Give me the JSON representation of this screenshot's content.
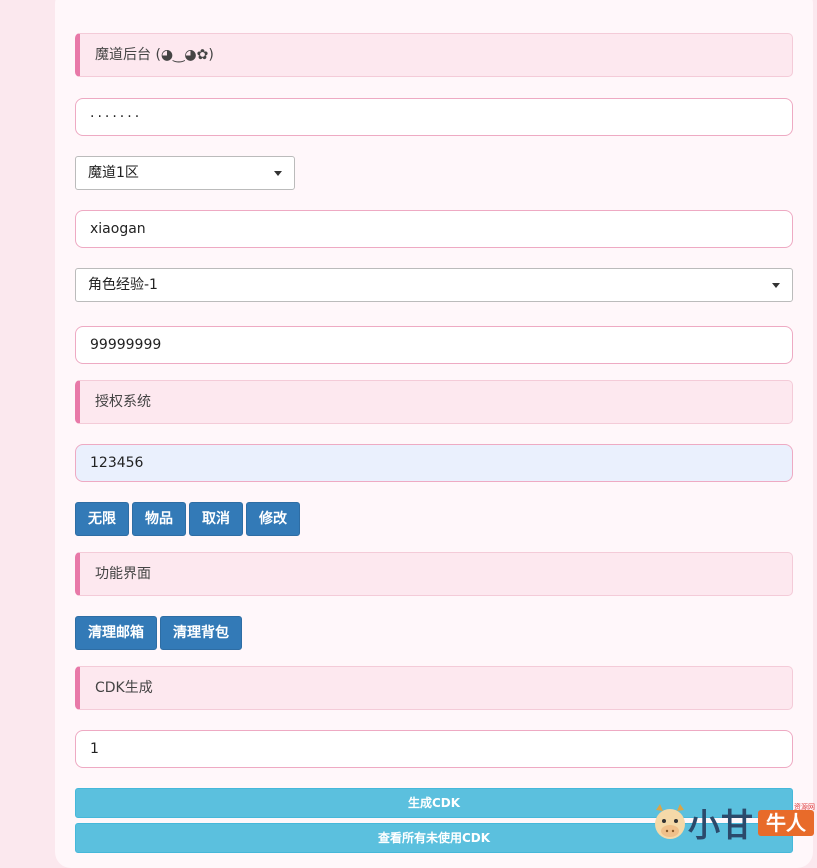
{
  "header_main": "魔道后台 (◕‿◕✿)",
  "password_field": {
    "value": "·······"
  },
  "server_select": {
    "selected": "魔道1区"
  },
  "username_field": {
    "value": "xiaogan"
  },
  "item_select": {
    "selected": "角色经验-1"
  },
  "amount_field": {
    "value": "99999999"
  },
  "auth_header": "授权系统",
  "auth_field": {
    "value": "123456"
  },
  "auth_buttons": [
    "无限",
    "物品",
    "取消",
    "修改"
  ],
  "func_header": "功能界面",
  "func_buttons": [
    "清理邮箱",
    "清理背包"
  ],
  "cdk_header": "CDK生成",
  "cdk_count_field": {
    "value": "1"
  },
  "cdk_generate_label": "生成CDK",
  "cdk_view_label": "查看所有未使用CDK",
  "watermark": {
    "text": "小甘",
    "box_text": "牛人",
    "tag": "资源网"
  },
  "colors": {
    "accent_pink": "#e879a8",
    "primary_button": "#337ab7",
    "info_button": "#5bc0de",
    "page_bg": "#fbe8ee"
  }
}
